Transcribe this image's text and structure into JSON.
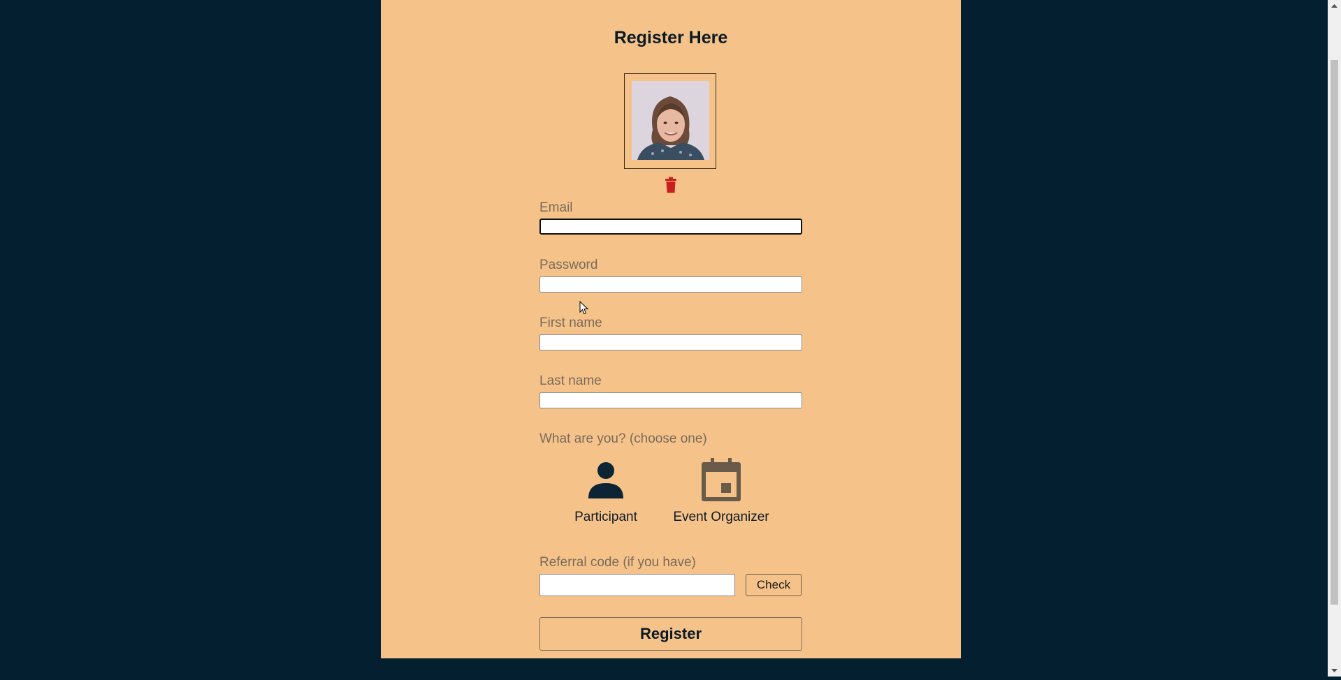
{
  "form": {
    "title": "Register Here",
    "email_label": "Email",
    "email_value": "",
    "password_label": "Password",
    "password_value": "",
    "first_name_label": "First name",
    "first_name_value": "",
    "last_name_label": "Last name",
    "last_name_value": "",
    "role_question": "What are you? (choose one)",
    "roles": [
      {
        "label": "Participant",
        "icon": "person-icon",
        "color": "#0c2434"
      },
      {
        "label": "Event Organizer",
        "icon": "calendar-icon",
        "color": "#6a5a4a"
      }
    ],
    "referral_label": "Referral code (if you have)",
    "referral_value": "",
    "check_label": "Check",
    "register_label": "Register"
  },
  "photo": {
    "icon": "profile-photo",
    "delete_icon": "trash-icon",
    "delete_color": "#c8201e"
  },
  "colors": {
    "page_background": "#041f30",
    "card_background": "#f5c38a",
    "label_text": "#7a6a5a"
  }
}
